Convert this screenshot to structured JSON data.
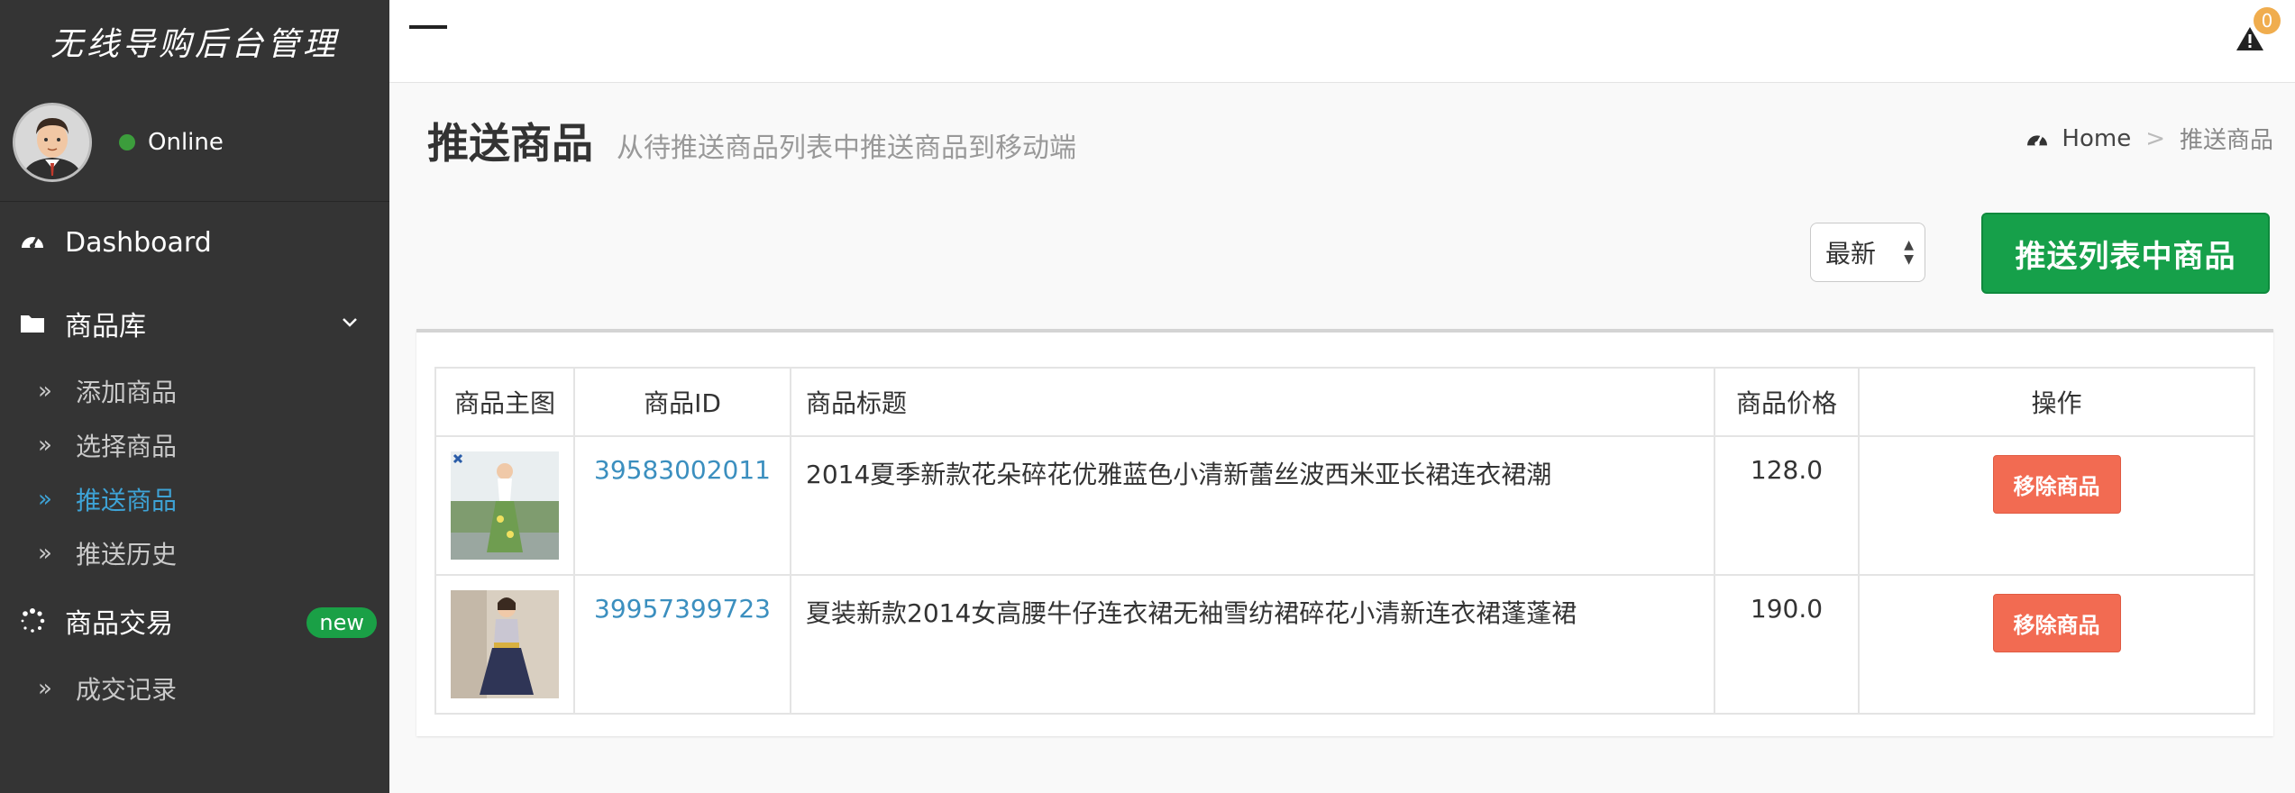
{
  "sidebar": {
    "brand": "无线导购后台管理",
    "user_status": "Online",
    "items": [
      {
        "label": "Dashboard",
        "icon": "dashboard-icon"
      },
      {
        "label": "商品库",
        "icon": "folder-icon",
        "children": [
          {
            "label": "添加商品"
          },
          {
            "label": "选择商品"
          },
          {
            "label": "推送商品",
            "active": true
          },
          {
            "label": "推送历史"
          }
        ]
      },
      {
        "label": "商品交易",
        "icon": "spinner-icon",
        "badge": "new",
        "children": [
          {
            "label": "成交记录"
          }
        ]
      }
    ]
  },
  "topbar": {
    "alert_count": "0"
  },
  "page": {
    "title": "推送商品",
    "subtitle": "从待推送商品列表中推送商品到移动端",
    "breadcrumb": {
      "home": "Home",
      "separator": ">",
      "current": "推送商品"
    }
  },
  "toolbar": {
    "sort_value": "最新",
    "push_label": "推送列表中商品"
  },
  "table": {
    "headers": [
      "商品主图",
      "商品ID",
      "商品标题",
      "商品价格",
      "操作"
    ],
    "rows": [
      {
        "id": "39583002011",
        "title": "2014夏季新款花朵碎花优雅蓝色小清新蕾丝波西米亚长裙连衣裙潮",
        "price": "128.0",
        "action": "移除商品"
      },
      {
        "id": "39957399723",
        "title": "夏装新款2014女高腰牛仔连衣裙无袖雪纺裙碎花小清新连衣裙蓬蓬裙",
        "price": "190.0",
        "action": "移除商品"
      }
    ]
  },
  "colors": {
    "sidebar_bg": "#343434",
    "accent_blue": "#3ea3d6",
    "push_green": "#16a04a",
    "remove_red": "#f26b52",
    "badge_green": "#1aa046"
  }
}
